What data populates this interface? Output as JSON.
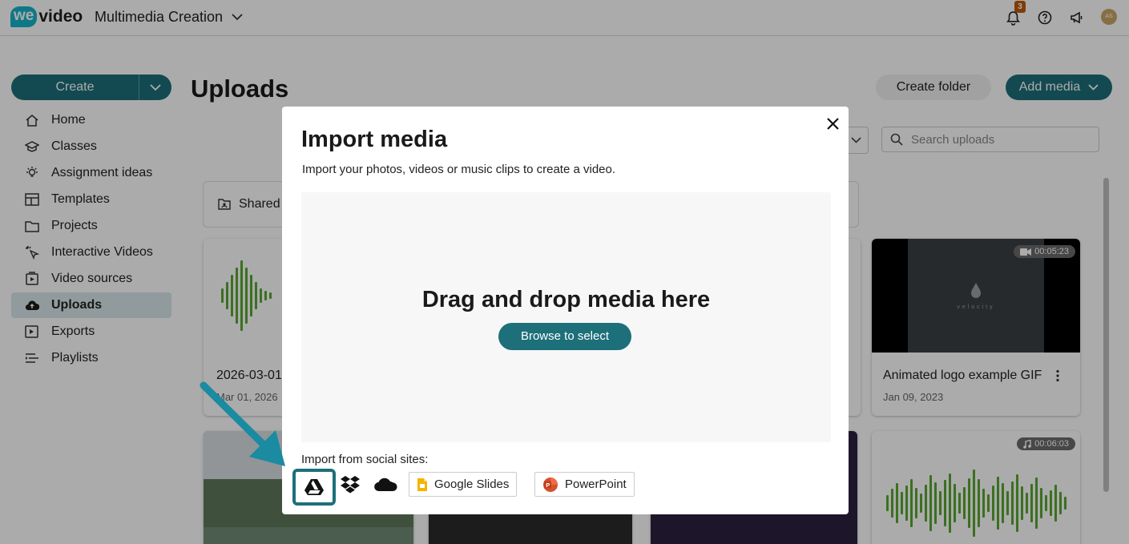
{
  "app": {
    "logo_bubble": "we",
    "logo_text": "video",
    "workspace": "Multimedia Creation",
    "notification_count": "3",
    "avatar_initials": "AS",
    "accent_color": "#1d6f7a",
    "brand_color": "#17b3c9"
  },
  "sidebar": {
    "create_label": "Create",
    "items": [
      {
        "label": "Home",
        "icon": "home-icon"
      },
      {
        "label": "Classes",
        "icon": "classes-icon"
      },
      {
        "label": "Assignment ideas",
        "icon": "lightbulb-icon"
      },
      {
        "label": "Templates",
        "icon": "templates-icon"
      },
      {
        "label": "Projects",
        "icon": "folder-icon"
      },
      {
        "label": "Interactive Videos",
        "icon": "cursor-click-icon"
      },
      {
        "label": "Video sources",
        "icon": "video-sources-icon"
      },
      {
        "label": "Uploads",
        "icon": "cloud-upload-icon",
        "active": true
      },
      {
        "label": "Exports",
        "icon": "export-icon"
      },
      {
        "label": "Playlists",
        "icon": "playlist-icon"
      }
    ]
  },
  "page": {
    "title": "Uploads",
    "create_folder_label": "Create folder",
    "add_media_label": "Add media",
    "search_placeholder": "Search uploads",
    "shared_folder_label": "Shared"
  },
  "cards": [
    {
      "title": "2026-03-01",
      "date": "Mar 01, 2026"
    },
    {
      "title": "Animated logo example GIF",
      "date": "Jan 09, 2023",
      "duration": "00:05:23",
      "thumb_text": "velocity"
    },
    {
      "duration": "00:06:03"
    }
  ],
  "modal": {
    "title": "Import media",
    "subtitle": "Import your photos, videos or music clips to create a video.",
    "drop_title": "Drag and drop media here",
    "browse_label": "Browse to select",
    "social_label": "Import from social sites:",
    "google_slides_label": "Google Slides",
    "powerpoint_label": "PowerPoint"
  }
}
